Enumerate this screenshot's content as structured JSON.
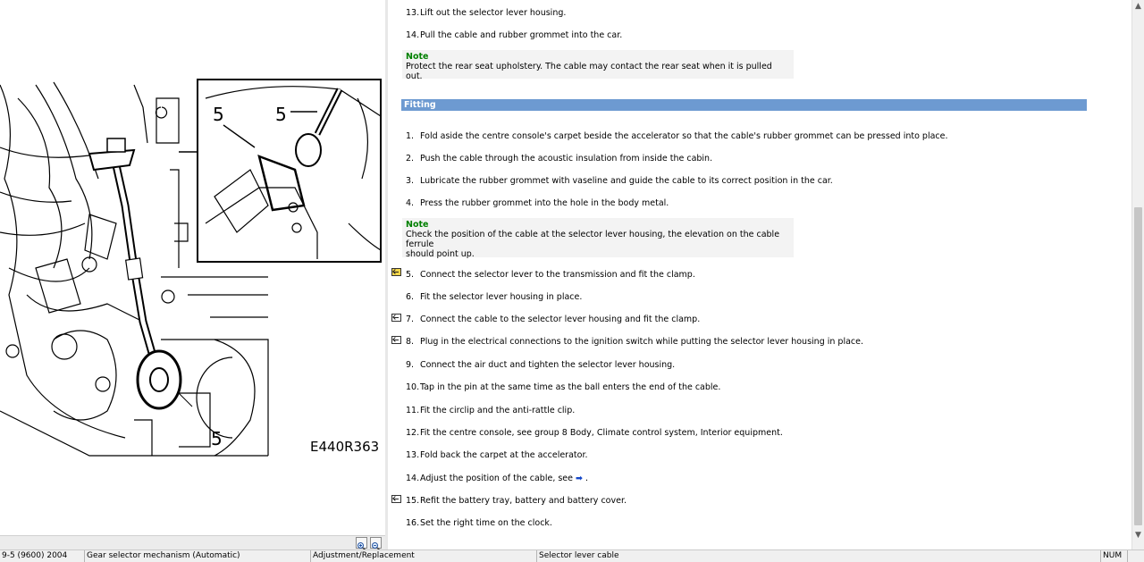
{
  "diagram": {
    "callouts": [
      "5",
      "5",
      "5"
    ],
    "figure_code": "E440R363"
  },
  "top_steps": [
    {
      "num": "13.",
      "text": "Lift out the selector lever housing."
    },
    {
      "num": "14.",
      "text": "Pull the cable and rubber grommet into the car."
    }
  ],
  "note1": {
    "title": "Note",
    "text": "Protect the rear seat upholstery. The cable may contact the rear seat when it is pulled out."
  },
  "fitting": {
    "title": "Fitting",
    "steps": [
      {
        "num": "1.",
        "text": "Fold aside the centre console's carpet beside the accelerator so that the cable's rubber grommet can be pressed into place."
      },
      {
        "num": "2.",
        "text": "Push the cable through the acoustic insulation from inside the cabin."
      },
      {
        "num": "3.",
        "text": "Lubricate the rubber grommet with vaseline and guide the cable to its correct position in the car."
      },
      {
        "num": "4.",
        "text": "Press the rubber grommet into the hole in the body metal."
      }
    ],
    "note": {
      "title": "Note",
      "line1": "Check the position of the cable at the selector lever housing, the elevation on the cable ferrule",
      "line2": "should point up."
    },
    "more_steps": [
      {
        "num": "5.",
        "text": "Connect the selector lever to the transmission and fit the clamp.",
        "icon": "step-link-icon-yellow"
      },
      {
        "num": "6.",
        "text": "Fit the selector lever housing in place."
      },
      {
        "num": "7.",
        "text": "Connect the cable to the selector lever housing and fit the clamp.",
        "icon": "step-link-icon"
      },
      {
        "num": "8.",
        "text": "Plug in the electrical connections to the ignition switch while putting the selector lever housing in place.",
        "icon": "step-link-icon"
      },
      {
        "num": "9.",
        "text": "Connect the air duct and tighten the selector lever housing."
      },
      {
        "num": "10.",
        "text": "Tap in the pin at the same time as the ball enters the end of the cable."
      },
      {
        "num": "11.",
        "text": "Fit the circlip and the anti-rattle clip."
      },
      {
        "num": "12.",
        "text": "Fit the centre console, see group 8 Body, Climate control system, Interior equipment."
      },
      {
        "num": "13.",
        "text": "Fold back the carpet at the accelerator."
      },
      {
        "num": "14.",
        "text": "Adjust the position of the cable, see",
        "link": "➡",
        "suffix": " ."
      },
      {
        "num": "15.",
        "text": "Refit the battery tray, battery and battery cover.",
        "icon": "step-link-icon"
      },
      {
        "num": "16.",
        "text": "Set the right time on the clock."
      }
    ]
  },
  "statusbar": {
    "model": "9-5 (9600) 2004",
    "section": "Gear selector mechanism (Automatic)",
    "operation": "Adjustment/Replacement",
    "item": "Selector lever cable",
    "numlock": "NUM"
  },
  "icons": {
    "zoom_in": "zoom-in-icon",
    "zoom_out": "zoom-out-icon",
    "scroll_up": "scroll-up-arrow",
    "scroll_down": "scroll-down-arrow"
  },
  "colors": {
    "section_bar": "#6d9ad1",
    "note_title": "#008000",
    "link_arrow": "#1447c8"
  }
}
